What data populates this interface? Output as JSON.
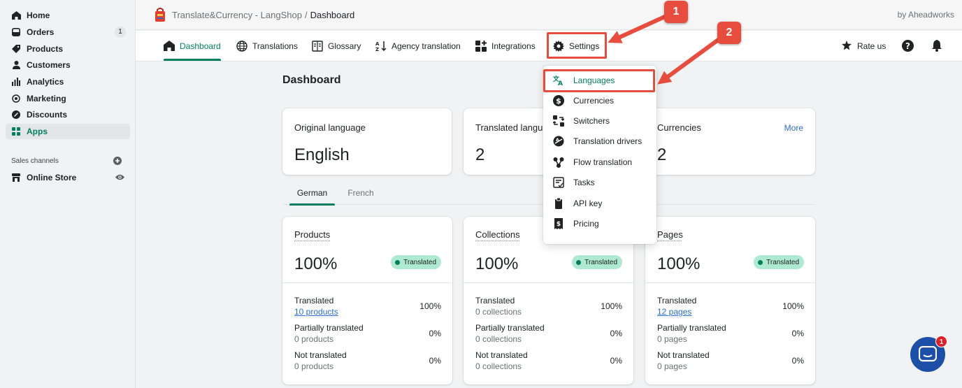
{
  "sidebar": {
    "items": [
      {
        "label": "Home",
        "icon": "home-icon"
      },
      {
        "label": "Orders",
        "icon": "orders-icon",
        "count": "1"
      },
      {
        "label": "Products",
        "icon": "tag-icon"
      },
      {
        "label": "Customers",
        "icon": "person-icon"
      },
      {
        "label": "Analytics",
        "icon": "bar-chart-icon"
      },
      {
        "label": "Marketing",
        "icon": "target-icon"
      },
      {
        "label": "Discounts",
        "icon": "discount-icon"
      },
      {
        "label": "Apps",
        "icon": "apps-icon"
      }
    ],
    "channels_title": "Sales channels",
    "online_store": "Online Store"
  },
  "header": {
    "app_name": "Translate&Currency - LangShop",
    "separator": "/",
    "current": "Dashboard",
    "by": "by Aheadworks"
  },
  "tabs": {
    "dashboard": "Dashboard",
    "translations": "Translations",
    "glossary": "Glossary",
    "agency": "Agency translation",
    "integrations": "Integrations",
    "settings": "Settings",
    "rate": "Rate us"
  },
  "main": {
    "title": "Dashboard",
    "summary": [
      {
        "label": "Original language",
        "value": "English"
      },
      {
        "label": "Translated langu",
        "value": "2"
      },
      {
        "label": "Currencies",
        "value": "2",
        "more": "More"
      }
    ],
    "lang_tabs": [
      "German",
      "French"
    ],
    "resources": [
      {
        "title": "Products",
        "pct": "100%",
        "badge": "Translated",
        "rows": [
          {
            "label": "Translated",
            "sub": "10 products",
            "pct": "100%"
          },
          {
            "label": "Partially translated",
            "sub": "0 products",
            "pct": "0%"
          },
          {
            "label": "Not translated",
            "sub": "0 products",
            "pct": "0%"
          }
        ]
      },
      {
        "title": "Collections",
        "pct": "100%",
        "badge": "Translated",
        "rows": [
          {
            "label": "Translated",
            "sub": "0 collections",
            "pct": "100%"
          },
          {
            "label": "Partially translated",
            "sub": "0 collections",
            "pct": "0%"
          },
          {
            "label": "Not translated",
            "sub": "0 collections",
            "pct": "0%"
          }
        ]
      },
      {
        "title": "Pages",
        "pct": "100%",
        "badge": "Translated",
        "rows": [
          {
            "label": "Translated",
            "sub": "12 pages",
            "pct": "100%"
          },
          {
            "label": "Partially translated",
            "sub": "0 pages",
            "pct": "0%"
          },
          {
            "label": "Not translated",
            "sub": "0 pages",
            "pct": "0%"
          }
        ]
      }
    ]
  },
  "settings_menu": {
    "items": [
      "Languages",
      "Currencies",
      "Switchers",
      "Translation drivers",
      "Flow translation",
      "Tasks",
      "API key",
      "Pricing"
    ]
  },
  "annotations": {
    "callout_1": "1",
    "callout_2": "2"
  },
  "chat": {
    "badge": "1"
  },
  "colors": {
    "accent": "#008060",
    "annotation": "#e74c3c",
    "link": "#2c6ecb",
    "badge_bg": "#aee9d1",
    "chat": "#1b4fa8"
  }
}
